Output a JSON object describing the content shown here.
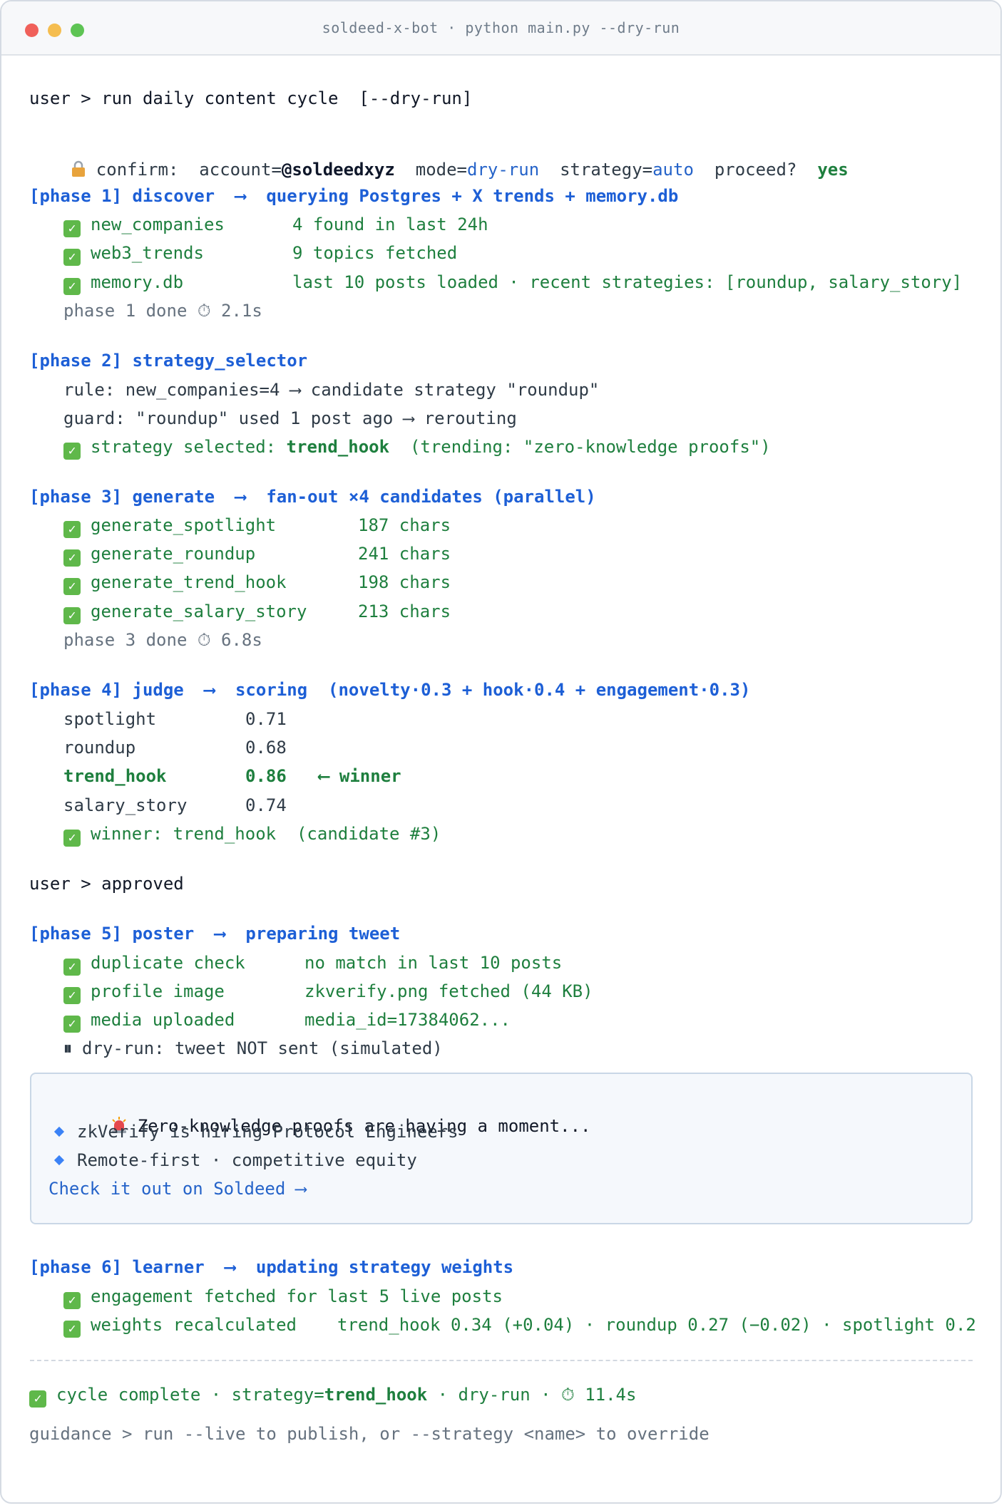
{
  "window": {
    "title": "soldeed-x-bot · python main.py --dry-run"
  },
  "colors": {
    "accent_blue": "#1d5fd6",
    "success_green": "#1e7f3e",
    "check_bg": "#5fb84a"
  },
  "prompt": {
    "user_cmd": "user > run daily content cycle  [--dry-run]",
    "confirm_label": "confirm:",
    "account_label": "account=",
    "account_value": "@soldeedxyz",
    "mode_label": "mode=",
    "mode_value": "dry-run",
    "strategy_label": "strategy=",
    "strategy_value": "auto",
    "proceed_label": "proceed?",
    "proceed_value": "yes"
  },
  "phase1": {
    "header": "[phase 1] discover  ⟶  querying Postgres + X trends + memory.db",
    "rows": [
      {
        "name": "new_companies",
        "value": "4 found in last 24h"
      },
      {
        "name": "web3_trends",
        "value": "9 topics fetched"
      },
      {
        "name": "memory.db",
        "value": "last 10 posts loaded · recent strategies: [roundup, salary_story]"
      }
    ],
    "done": "phase 1 done ⏱ 2.1s"
  },
  "phase2": {
    "header": "[phase 2] strategy_selector",
    "rule": "rule: new_companies=4 ⟶ candidate strategy \"roundup\"",
    "guard": "guard: \"roundup\" used 1 post ago ⟶ rerouting",
    "selected_prefix": "strategy selected: ",
    "selected_value": "trend_hook",
    "selected_suffix": "  (trending: \"zero-knowledge proofs\")"
  },
  "phase3": {
    "header": "[phase 3] generate  ⟶  fan-out ×4 candidates (parallel)",
    "rows": [
      {
        "name": "generate_spotlight",
        "value": "187 chars"
      },
      {
        "name": "generate_roundup",
        "value": "241 chars"
      },
      {
        "name": "generate_trend_hook",
        "value": "198 chars"
      },
      {
        "name": "generate_salary_story",
        "value": "213 chars"
      }
    ],
    "done": "phase 3 done ⏱ 6.8s"
  },
  "phase4": {
    "header": "[phase 4] judge  ⟶  scoring  (novelty·0.3 + hook·0.4 + engagement·0.3)",
    "scores": [
      {
        "name": "spotlight",
        "score": "0.71"
      },
      {
        "name": "roundup",
        "score": "0.68"
      },
      {
        "name": "trend_hook",
        "score": "0.86",
        "tag": "⟵ winner"
      },
      {
        "name": "salary_story",
        "score": "0.74"
      }
    ],
    "winner": "winner: trend_hook  (candidate #3)"
  },
  "user_approved": "user > approved",
  "phase5": {
    "header": "[phase 5] poster  ⟶  preparing tweet",
    "rows": [
      {
        "name": "duplicate check",
        "value": "no match in last 10 posts"
      },
      {
        "name": "profile image",
        "value": "zkverify.png fetched (44 KB)"
      },
      {
        "name": "media uploaded",
        "value": "media_id=17384062..."
      }
    ],
    "pause_icon": "⏸",
    "dryrun_note": "dry-run: tweet NOT sent (simulated)"
  },
  "tweet": {
    "line1": "Zero-knowledge proofs are having a moment...",
    "line2": "zkVerify is hiring Protocol Engineers",
    "line3": "Remote-first · competitive equity",
    "cta": "Check it out on Soldeed ⟶"
  },
  "phase6": {
    "header": "[phase 6] learner  ⟶  updating strategy weights",
    "row1": "engagement fetched for last 5 live posts",
    "row2_label": "weights recalculated",
    "row2_value": "trend_hook 0.34 (+0.04) · roundup 0.27 (−0.02) · spotlight 0.2"
  },
  "summary": {
    "prefix": "cycle complete · strategy=",
    "strategy": "trend_hook",
    "suffix": " · dry-run · ⏱ 11.4s",
    "guidance": "guidance > run --live to publish, or --strategy <name> to override"
  }
}
